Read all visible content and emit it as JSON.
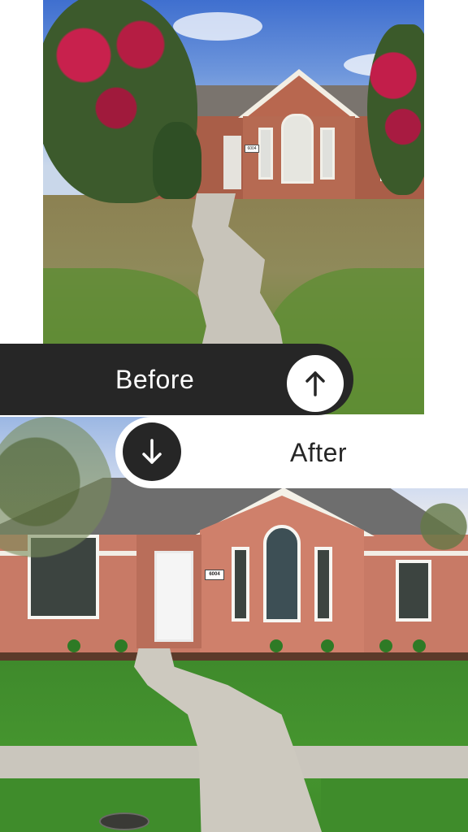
{
  "labels": {
    "before": "Before",
    "after": "After"
  },
  "house_number": "6004",
  "icons": {
    "before_circle": "arrow-up-icon",
    "after_circle": "arrow-down-icon"
  },
  "colors": {
    "bar_dark": "#262626",
    "bar_light": "#ffffff"
  }
}
